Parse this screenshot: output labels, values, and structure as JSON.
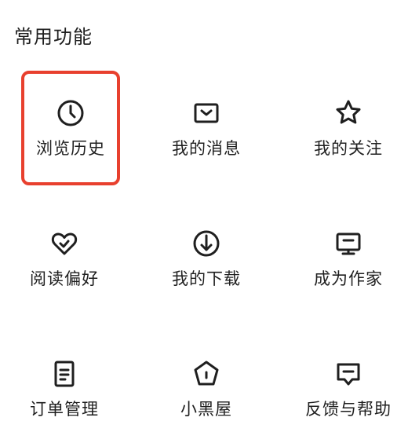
{
  "section": {
    "title": "常用功能"
  },
  "items": [
    {
      "label": "浏览历史",
      "icon": "clock-icon"
    },
    {
      "label": "我的消息",
      "icon": "message-inbox-icon"
    },
    {
      "label": "我的关注",
      "icon": "star-icon"
    },
    {
      "label": "阅读偏好",
      "icon": "heart-check-icon"
    },
    {
      "label": "我的下载",
      "icon": "download-icon"
    },
    {
      "label": "成为作家",
      "icon": "monitor-icon"
    },
    {
      "label": "订单管理",
      "icon": "document-icon"
    },
    {
      "label": "小黑屋",
      "icon": "pentagon-house-icon"
    },
    {
      "label": "反馈与帮助",
      "icon": "feedback-icon"
    }
  ],
  "colors": {
    "highlight": "#e8402e",
    "icon_stroke": "#1f1f1f",
    "text": "#1f1f1f"
  }
}
